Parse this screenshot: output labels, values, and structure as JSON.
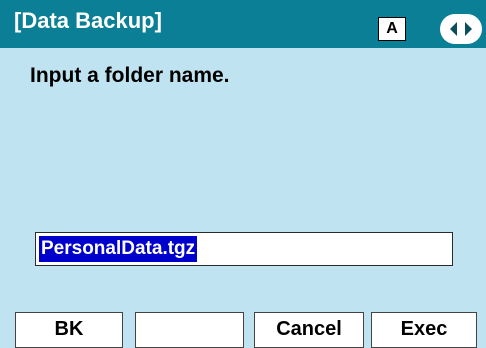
{
  "header": {
    "title": "[Data Backup]",
    "mode_badge": "A",
    "nav_icon": "left-right-arrows-icon"
  },
  "main": {
    "prompt": "Input a folder name.",
    "folder_name_input": {
      "value": "PersonalData.tgz"
    }
  },
  "softkeys": {
    "sk1_label": "BK",
    "sk2_label": "",
    "sk3_label": "Cancel",
    "sk4_label": "Exec"
  },
  "colors": {
    "header_bg": "#0a7f96",
    "screen_bg": "#bfe3f0",
    "selection_bg": "#0000cc"
  }
}
